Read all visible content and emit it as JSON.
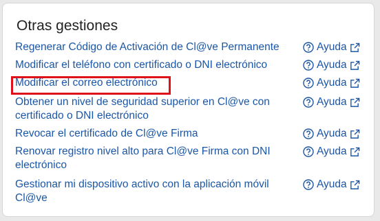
{
  "title": "Otras gestiones",
  "help_label": "Ayuda",
  "accent_color": "#1a56a8",
  "highlight_color": "#e0101a",
  "items": [
    {
      "label": "Regenerar Código de Activación de Cl@ve Permanente"
    },
    {
      "label": "Modificar el teléfono con certificado o DNI electrónico"
    },
    {
      "label": "Modificar el correo electrónico",
      "highlighted": true
    },
    {
      "label": "Obtener un nivel de seguridad superior en Cl@ve con certificado o DNI electrónico"
    },
    {
      "label": "Revocar el certificado de Cl@ve Firma"
    },
    {
      "label": "Renovar registro nivel alto para Cl@ve Firma con DNI electrónico"
    },
    {
      "label": "Gestionar mi dispositivo activo con la aplicación móvil Cl@ve"
    }
  ]
}
